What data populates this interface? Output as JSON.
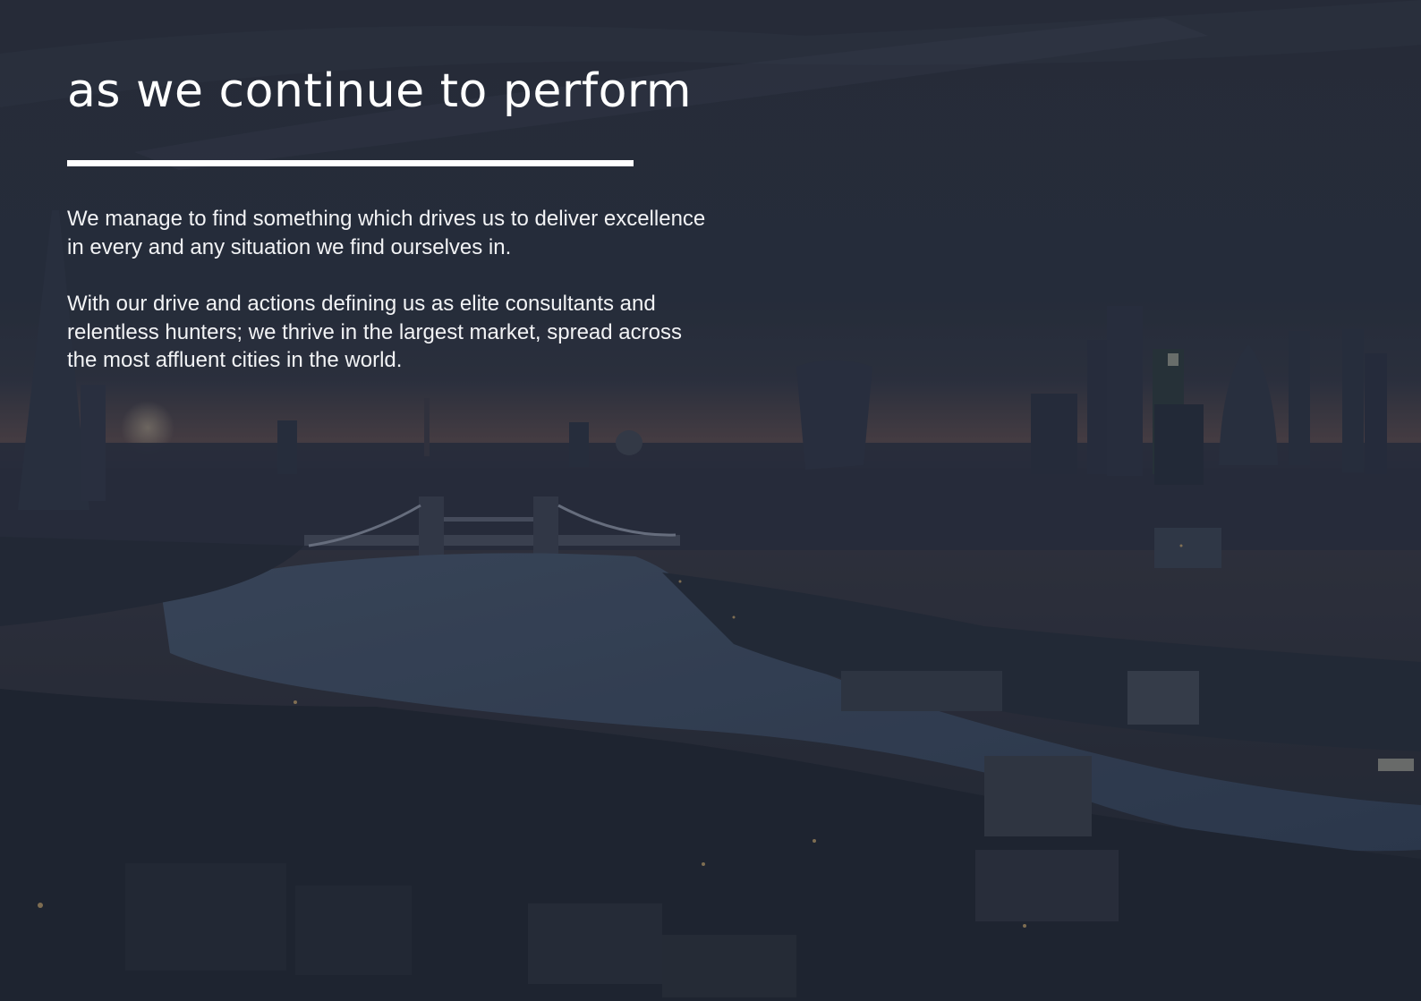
{
  "headline": "as we continue to perform",
  "paragraphs": [
    "We manage to find something which drives us to deliver excellence in every and any situation we find ourselves in.",
    "With our drive and actions defining us as elite consultants and relentless hunters; we thrive in the largest market, spread across the most affluent cities in the world."
  ],
  "colors": {
    "overlay": "#232a37",
    "text": "#ffffff",
    "river": "#3d4d63",
    "sky_glow": "#7a5a52"
  }
}
